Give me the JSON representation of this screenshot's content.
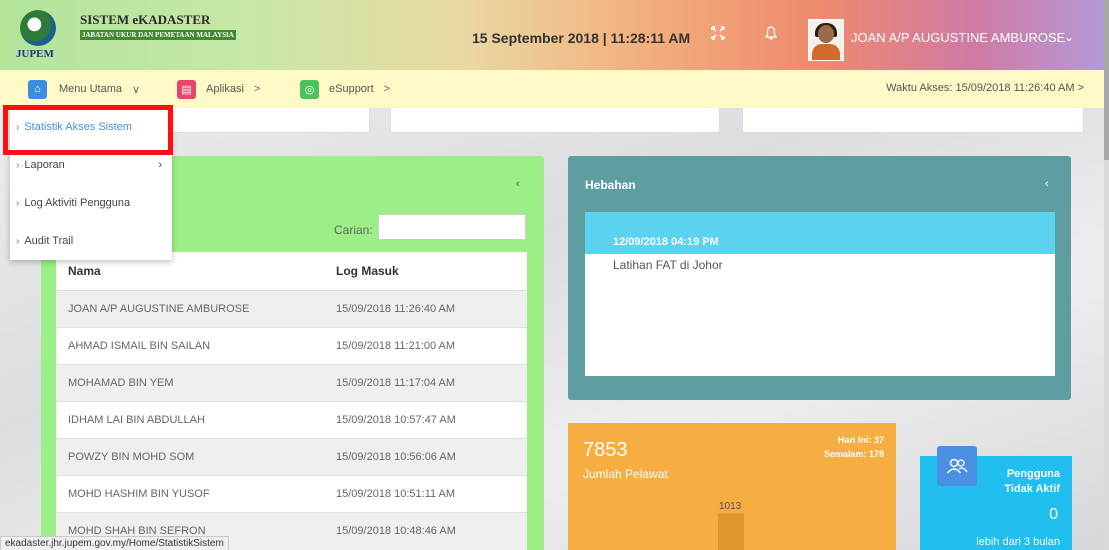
{
  "header": {
    "logo_text": "JUPEM",
    "brand_title": "SISTEM eKADASTER",
    "brand_sub": "JABATAN UKUR DAN PEMETAAN MALAYSIA",
    "datetime": "15 September 2018 | 11:28:11 AM",
    "icons": [
      "fullscreen-icon",
      "bell-icon"
    ],
    "user_name": "JOAN A/P AUGUSTINE AMBUROSE",
    "user_chevron": "⌄"
  },
  "menubar": {
    "items": [
      {
        "label": "Menu Utama",
        "icon": "home-icon",
        "icon_color": "#3b8de0",
        "chevron": "∨"
      },
      {
        "label": "Aplikasi",
        "icon": "app-icon",
        "icon_color": "#e8456a",
        "chevron": ">"
      },
      {
        "label": "eSupport",
        "icon": "support-icon",
        "icon_color": "#4cc35a",
        "chevron": ">"
      }
    ],
    "access_time": "Waktu Akses: 15/09/2018 11:26:40 AM  >"
  },
  "dropdown": {
    "items": [
      {
        "label": "Statistik Akses Sistem"
      },
      {
        "label": "Laporan"
      },
      {
        "label": "Log Aktiviti Pengguna"
      },
      {
        "label": "Audit Trail"
      }
    ]
  },
  "left_panel": {
    "search_label": "Carian:",
    "search_value": "",
    "columns": [
      "Nama",
      "Log Masuk"
    ],
    "rows": [
      [
        "JOAN A/P AUGUSTINE AMBUROSE",
        "15/09/2018 11:26:40 AM"
      ],
      [
        "AHMAD ISMAIL BIN SAILAN",
        "15/09/2018 11:21:00 AM"
      ],
      [
        "MOHAMAD BIN YEM",
        "15/09/2018 11:17:04 AM"
      ],
      [
        "IDHAM LAI BIN ABDULLAH",
        "15/09/2018 10:57:47 AM"
      ],
      [
        "POWZY BIN MOHD SOM",
        "15/09/2018 10:56:06 AM"
      ],
      [
        "MOHD HASHIM BIN YUSOF",
        "15/09/2018 10:51:11 AM"
      ],
      [
        "MOHD SHAH BIN SEFRON",
        "15/09/2018 10:48:46 AM"
      ]
    ]
  },
  "right_panel": {
    "title": "Hebahan",
    "news_date": "12/09/2018 04:19 PM",
    "news_text": "Latihan FAT di Johor"
  },
  "visitor_card": {
    "count": "7853",
    "label": "Jumlah Pelawat",
    "today": "Hari Ini: 37",
    "yesterday": "Semalam: 178",
    "bar_label": "1013"
  },
  "inactive_card": {
    "title_line1": "Pengguna",
    "title_line2": "Tidak Aktif",
    "value": "0",
    "sub": "lebih dari 3 bulan"
  },
  "status_url": "ekadaster.jhr.jupem.gov.my/Home/StatistikSistem",
  "colors": {
    "menubar_bg": "#fff9c8",
    "left_panel": "#9bef86",
    "right_panel": "#5f9ea0",
    "news_header": "#5bd2f0",
    "visitor_card": "#f6ad42",
    "inactive_card": "#20bfef",
    "highlight": "#ff1010"
  }
}
